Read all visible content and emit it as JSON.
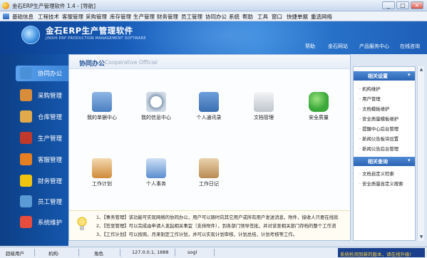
{
  "window": {
    "title": "金石ERP生产管理软件 1.4 - [导航]",
    "min": "_",
    "max": "□",
    "close": "×"
  },
  "menu": [
    "基础信息",
    "工程技术",
    "客服管理",
    "采购管理",
    "库存管理",
    "生产管理",
    "财务管理",
    "员工管理",
    "协同办公",
    "系统",
    "帮助",
    "工具",
    "窗口",
    "快捷单据",
    "重选网络"
  ],
  "banner": {
    "brand_cn": "金石ERP生产管理软件",
    "brand_en": "JINSHI ERP PRODUCTION MANAGEMENT SOFTWARE",
    "links": [
      "帮助",
      "金石网站",
      "产品服务中心",
      "在线咨询"
    ]
  },
  "sidebar": {
    "items": [
      {
        "label": "协同办公",
        "icon": "collaboration-icon",
        "color": "#4a90d9"
      },
      {
        "label": "采购管理",
        "icon": "purchase-icon",
        "color": "#d98c3a"
      },
      {
        "label": "仓库管理",
        "icon": "warehouse-icon",
        "color": "#e0a94a"
      },
      {
        "label": "生产管理",
        "icon": "production-icon",
        "color": "#c0392b"
      },
      {
        "label": "客服管理",
        "icon": "customer-service-icon",
        "color": "#e67e22"
      },
      {
        "label": "财务管理",
        "icon": "finance-icon",
        "color": "#f1c40f"
      },
      {
        "label": "员工管理",
        "icon": "staff-icon",
        "color": "#5b9bd5"
      },
      {
        "label": "系统维护",
        "icon": "system-maintenance-icon",
        "color": "#e74c3c"
      }
    ]
  },
  "main": {
    "title": "协同办公",
    "subtitle": "Cooperative Official",
    "modules": [
      {
        "label": "我的单据中心",
        "icon": "document-center-icon",
        "color": "#4a7fc1"
      },
      {
        "label": "我的信息中心",
        "icon": "clock-message-icon",
        "color": "#8aa0b8"
      },
      {
        "label": "个人通讯录",
        "icon": "address-book-icon",
        "color": "#3b6fb0"
      },
      {
        "label": "文档管理",
        "icon": "document-gear-icon",
        "color": "#bfc5cc"
      },
      {
        "label": "安全质量",
        "icon": "shield-check-icon",
        "color": "#3aa83a"
      },
      {
        "label": "工作计划",
        "icon": "calendar-icon",
        "color": "#d08a3a"
      },
      {
        "label": "个人事务",
        "icon": "notepad-pen-icon",
        "color": "#5b8ed0"
      },
      {
        "label": "工作日记",
        "icon": "diary-icon",
        "color": "#b98b52"
      }
    ],
    "notices": [
      "1、【事务管理】该功能可实现网络的协同办公，用户可以随时向其它用户或所有用户发送消息，附件，接收人只要在线就",
      "2、【签至管理】可以完成由申请人发起相关事宜（支持附件），到各部门领导签批，并对该至相关部门存档的整个工作流",
      "3、【工作计划】可以按周，月来制定工作计划，并可以实现计划审核，计划总结，计划考核等工作。"
    ]
  },
  "rightpanel": {
    "sections": [
      {
        "title": "相关设置",
        "items": [
          "· 机构维护",
          "· 用户管理",
          "· 文档模板维护",
          "· 安全质量模板维护",
          "· 提醒中心后台管理",
          "· 新闻公告板块设置",
          "· 新闻公告后台管理"
        ]
      },
      {
        "title": "相关查询",
        "items": [
          "· 文档自定义检索",
          "· 安全质量自定义搜索"
        ]
      }
    ]
  },
  "status": {
    "user_label": "超级用户",
    "org_label": "机构:",
    "role_label": "角色",
    "ip": "127.0.0.1, 1888",
    "db": "sogl",
    "warning": "系统检测到新的版本，请在线升级!"
  }
}
